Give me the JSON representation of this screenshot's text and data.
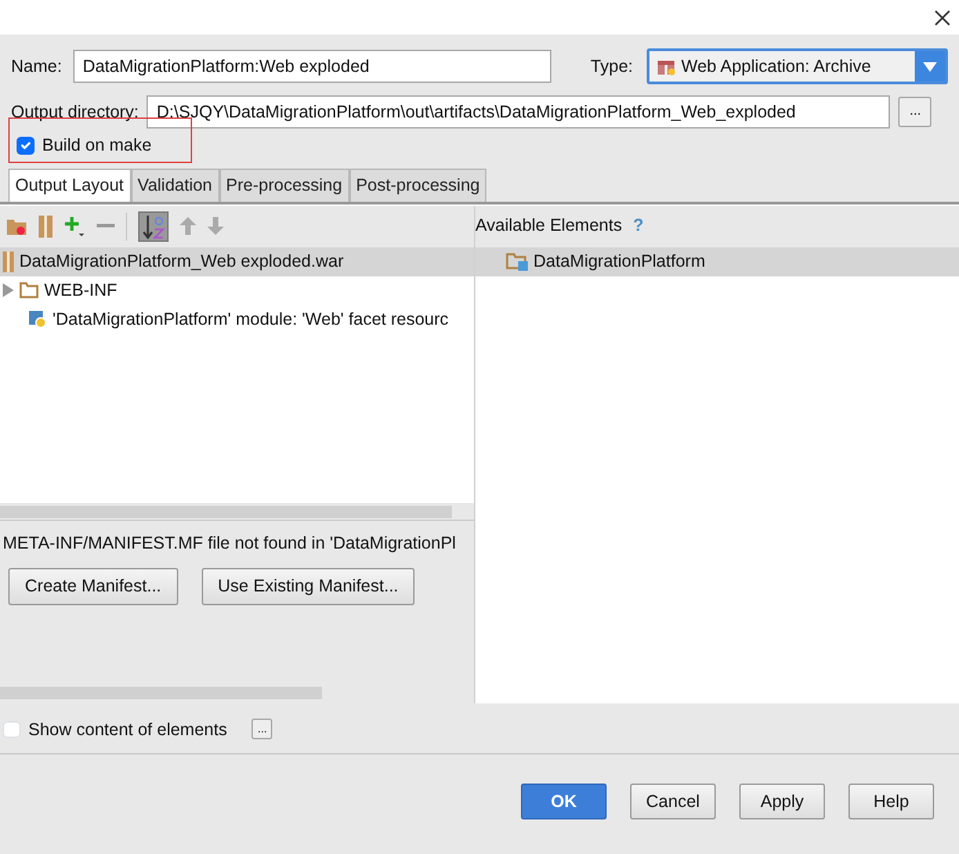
{
  "name_field": {
    "label": "Name:",
    "value": "DataMigrationPlatform:Web exploded"
  },
  "type_field": {
    "label": "Type:",
    "value": "Web Application: Archive"
  },
  "output_directory": {
    "label": "Output directory:",
    "value": "D:\\SJQY\\DataMigrationPlatform\\out\\artifacts\\DataMigrationPlatform_Web_exploded",
    "browse": "..."
  },
  "build_on_make": {
    "label": "Build on make",
    "checked": true
  },
  "tabs": [
    {
      "label": "Output Layout",
      "selected": true
    },
    {
      "label": "Validation",
      "selected": false
    },
    {
      "label": "Pre-processing",
      "selected": false
    },
    {
      "label": "Post-processing",
      "selected": false
    }
  ],
  "layout_tree": [
    {
      "kind": "archive",
      "label": "DataMigrationPlatform_Web exploded.war",
      "selected": true
    },
    {
      "kind": "folder",
      "label": "WEB-INF",
      "selected": false
    },
    {
      "kind": "resource",
      "label": "'DataMigrationPlatform' module: 'Web' facet resourc",
      "selected": false
    }
  ],
  "available_elements": {
    "title": "Available Elements",
    "help": "?",
    "items": [
      {
        "label": "DataMigrationPlatform",
        "selected": true
      }
    ]
  },
  "manifest": {
    "message": "META-INF/MANIFEST.MF file not found in 'DataMigrationPl",
    "buttons": [
      "Create Manifest...",
      "Use Existing Manifest..."
    ]
  },
  "show_content": {
    "label": "Show content of elements",
    "checked": false,
    "more": "..."
  },
  "buttons": [
    {
      "label": "OK",
      "kind": "primary"
    },
    {
      "label": "Cancel",
      "kind": "default"
    },
    {
      "label": "Apply",
      "kind": "default"
    },
    {
      "label": "Help",
      "kind": "default"
    }
  ]
}
